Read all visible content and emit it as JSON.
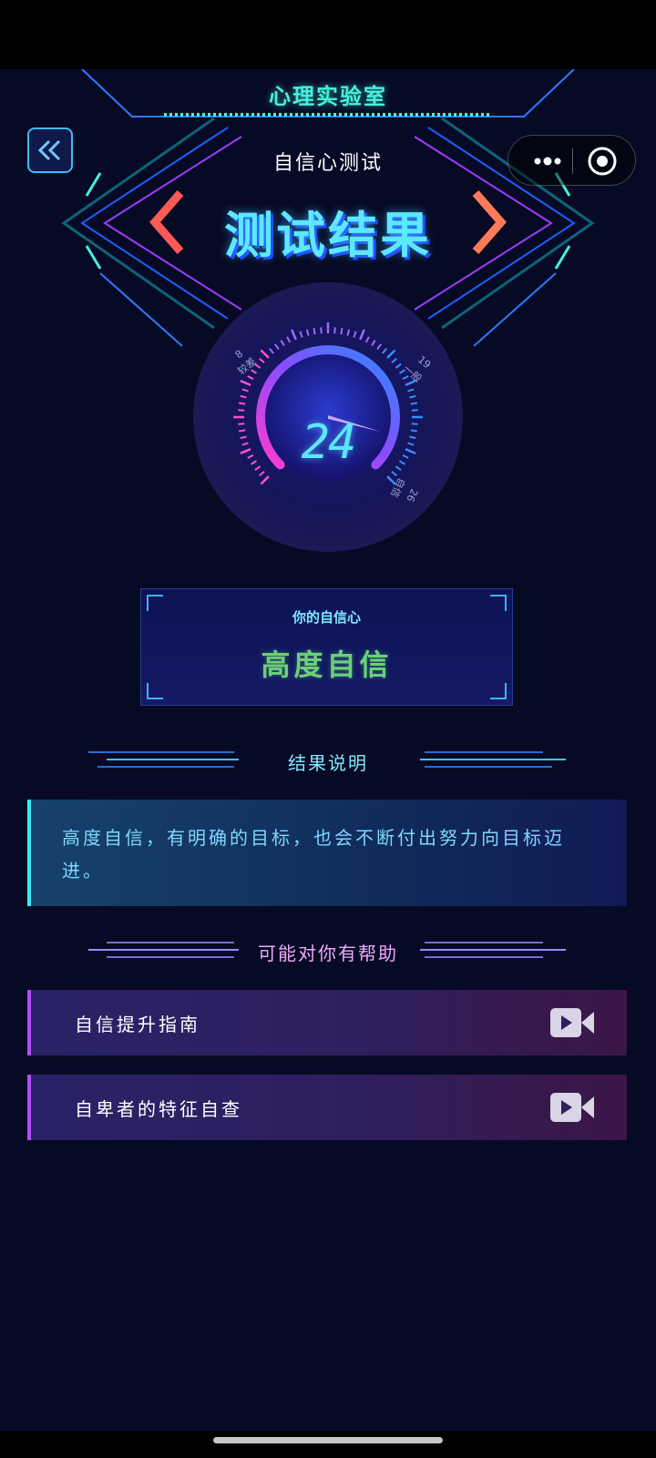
{
  "header": {
    "lab_title": "心理实验室",
    "subtitle": "自信心测试",
    "result_title": "测试结果"
  },
  "score": {
    "value": "24",
    "value_num": 24,
    "tick_labels": [
      "8",
      "19",
      "26"
    ],
    "zone_labels": [
      "较差",
      "一般",
      "自信"
    ]
  },
  "result": {
    "caption": "你的自信心",
    "level": "高度自信"
  },
  "explanation": {
    "heading": "结果说明",
    "text": "高度自信，有明确的目标，也会不断付出努力向目标迈进。"
  },
  "help": {
    "heading": "可能对你有帮助",
    "items": [
      {
        "label": "自信提升指南",
        "icon": "video-icon"
      },
      {
        "label": "自卑者的特征自查",
        "icon": "video-icon"
      }
    ]
  },
  "colors": {
    "background": "#070a24",
    "accent_cyan": "#46f0dc",
    "accent_blue": "#41b8ff",
    "accent_purple": "#b14cff",
    "result_green": "#6ad07a",
    "help_heading": "#f0a8ff"
  }
}
